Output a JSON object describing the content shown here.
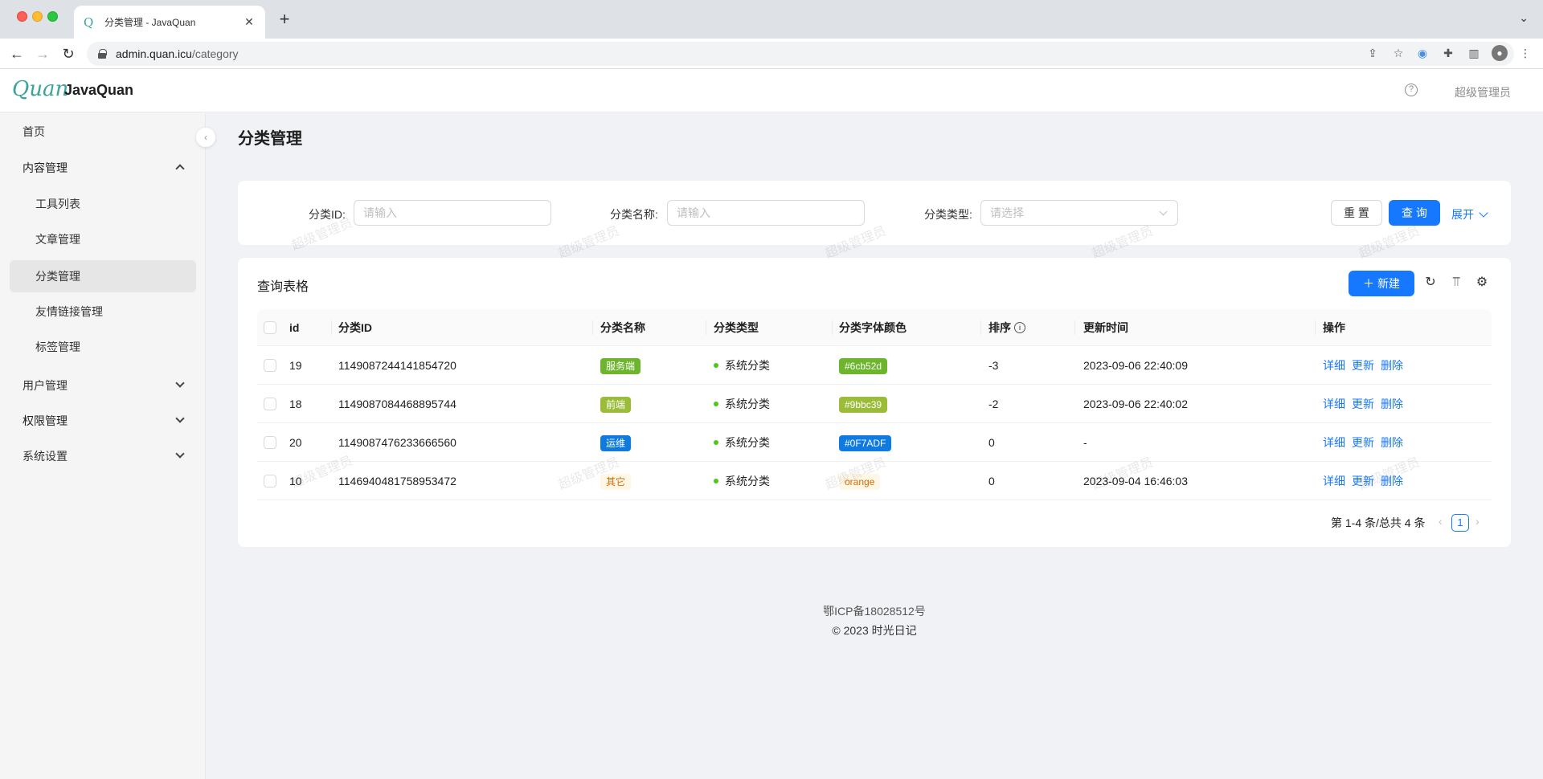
{
  "browser": {
    "tab_title": "分类管理 - JavaQuan",
    "favicon": "Q",
    "url_host": "admin.quan.icu",
    "url_path": "/category"
  },
  "header": {
    "logo_mark": "Quan",
    "logo_text": "JavaQuan",
    "user_name": "超级管理员"
  },
  "sidebar": {
    "items": [
      {
        "label": "首页"
      },
      {
        "label": "内容管理"
      },
      {
        "label": "工具列表"
      },
      {
        "label": "文章管理"
      },
      {
        "label": "分类管理"
      },
      {
        "label": "友情链接管理"
      },
      {
        "label": "标签管理"
      },
      {
        "label": "用户管理"
      },
      {
        "label": "权限管理"
      },
      {
        "label": "系统设置"
      }
    ]
  },
  "page": {
    "title": "分类管理"
  },
  "search": {
    "id_label": "分类ID:",
    "id_placeholder": "请输入",
    "name_label": "分类名称:",
    "name_placeholder": "请输入",
    "type_label": "分类类型:",
    "type_placeholder": "请选择",
    "reset_label": "重 置",
    "query_label": "查 询",
    "expand_label": "展开"
  },
  "table": {
    "title": "查询表格",
    "new_label": "新建",
    "columns": [
      "id",
      "分类ID",
      "分类名称",
      "分类类型",
      "分类字体颜色",
      "排序",
      "更新时间",
      "操作"
    ],
    "rows": [
      {
        "id": "19",
        "cid": "1149087244141854720",
        "name": "服务端",
        "name_bg": "#6cb52d",
        "name_fg": "#ffffff",
        "type": "系统分类",
        "color": "#6cb52d",
        "color_bg": "#6cb52d",
        "color_fg": "#ffffff",
        "sort": "-3",
        "updated": "2023-09-06 22:40:09"
      },
      {
        "id": "18",
        "cid": "1149087084468895744",
        "name": "前端",
        "name_bg": "#9bbc39",
        "name_fg": "#ffffff",
        "type": "系统分类",
        "color": "#9bbc39",
        "color_bg": "#9bbc39",
        "color_fg": "#ffffff",
        "sort": "-2",
        "updated": "2023-09-06 22:40:02"
      },
      {
        "id": "20",
        "cid": "1149087476233666560",
        "name": "运维",
        "name_bg": "#0F7ADF",
        "name_fg": "#ffffff",
        "type": "系统分类",
        "color": "#0F7ADF",
        "color_bg": "#0F7ADF",
        "color_fg": "#ffffff",
        "sort": "0",
        "updated": "-"
      },
      {
        "id": "10",
        "cid": "1146940481758953472",
        "name": "其它",
        "name_bg": "#fff7e6",
        "name_fg": "#d46b08",
        "type": "系统分类",
        "color": "orange",
        "color_bg": "#fff7e6",
        "color_fg": "#d46b08",
        "sort": "0",
        "updated": "2023-09-04 16:46:03"
      }
    ],
    "actions": [
      "详细",
      "更新",
      "删除"
    ]
  },
  "pagination": {
    "total_text": "第 1-4 条/总共 4 条",
    "current": "1"
  },
  "footer": {
    "icp": "鄂ICP备18028512号",
    "copyright": "© 2023 时光日记"
  },
  "watermark": "超级管理员"
}
